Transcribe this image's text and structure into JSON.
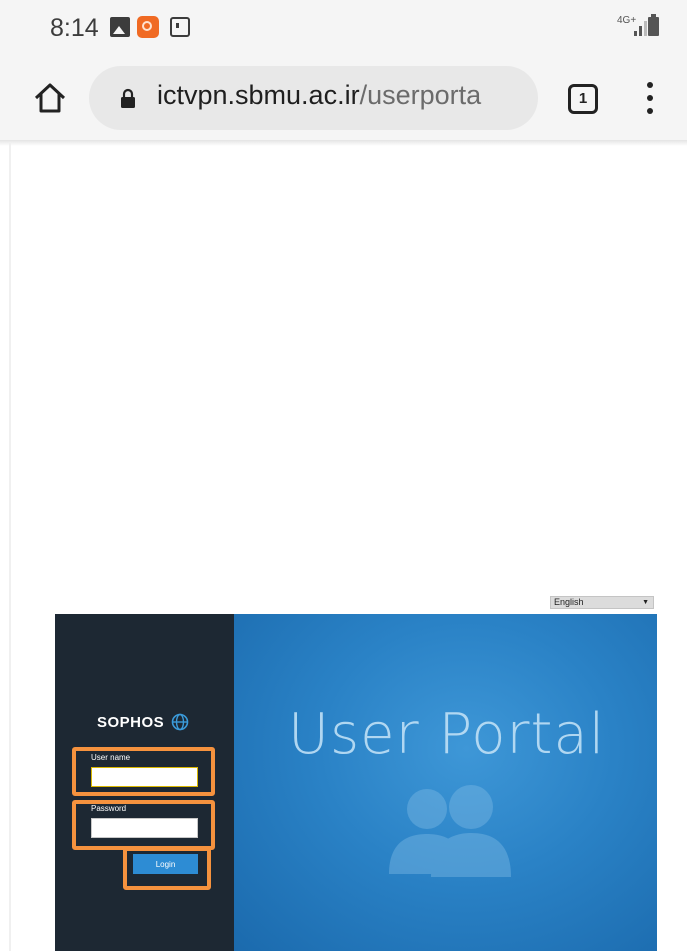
{
  "status_bar": {
    "time": "8:14",
    "network": "4G+",
    "icons": [
      "gallery-icon",
      "app-notification-icon",
      "screen-icon",
      "signal-icon",
      "battery-icon"
    ]
  },
  "browser": {
    "url_host": "ictvpn.sbmu.ac.ir",
    "url_path": "/userporta",
    "tab_count": "1",
    "icons": [
      "home-icon",
      "lock-icon",
      "tabs-icon",
      "more-menu-icon"
    ]
  },
  "portal": {
    "language": "English",
    "brand": "SOPHOS",
    "username_label": "User name",
    "username_value": "",
    "password_label": "Password",
    "password_value": "",
    "login_label": "Login",
    "title": "User Portal"
  },
  "colors": {
    "left_panel": "#1d2833",
    "right_panel": "#2a82c6",
    "highlight": "#f5923e",
    "login_button": "#2d8cd4"
  }
}
